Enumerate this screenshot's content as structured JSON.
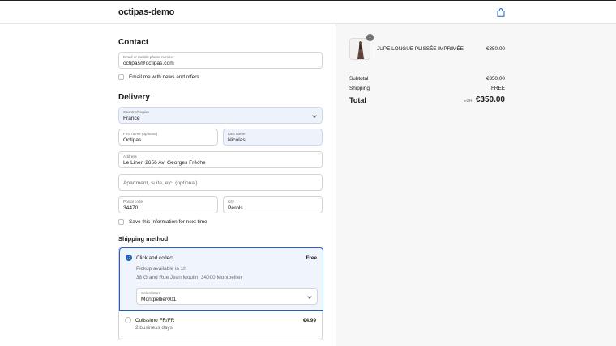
{
  "header": {
    "brand": "octipas-demo",
    "cart_icon": "shopping-bag-icon"
  },
  "contact": {
    "heading": "Contact",
    "email_label": "Email or mobile phone number",
    "email_value": "octipas@octipas.com",
    "newsletter_label": "Email me with news and offers"
  },
  "delivery": {
    "heading": "Delivery",
    "country_label": "Country/Region",
    "country_value": "France",
    "first_name_label": "First name (optional)",
    "first_name_value": "Octipas",
    "last_name_label": "Last name",
    "last_name_value": "Nicolas",
    "address_label": "Address",
    "address_value": "Le Liner, 2656 Av. Georges Frêche",
    "apartment_placeholder": "Apartment, suite, etc. (optional)",
    "postal_label": "Postal code",
    "postal_value": "34470",
    "city_label": "City",
    "city_value": "Pérols",
    "save_label": "Save this information for next time"
  },
  "shipping": {
    "heading": "Shipping method",
    "options": [
      {
        "name": "Click and collect",
        "price": "Free",
        "detail1": "Pickup available in 1h",
        "detail2": "38 Grand Rue Jean Moulin, 34000 Montpellier",
        "store_label": "Select store",
        "store_value": "Montpellier001",
        "selected": true
      },
      {
        "name": "Colissimo FR/FR",
        "price": "€4.99",
        "detail1": "2 business days",
        "selected": false
      }
    ]
  },
  "summary": {
    "item": {
      "quantity": "1",
      "name": "JUPE LONGUE PLISSÉE IMPRIMÉE",
      "price": "€350.00"
    },
    "subtotal_label": "Subtotal",
    "subtotal_value": "€350.00",
    "shipping_label": "Shipping",
    "shipping_value": "FREE",
    "total_label": "Total",
    "currency": "EUR",
    "total_value": "€350.00"
  },
  "colors": {
    "accent": "#1f5fbf",
    "field_fill": "#eef2fb",
    "summary_bg": "#f7f7f7"
  }
}
